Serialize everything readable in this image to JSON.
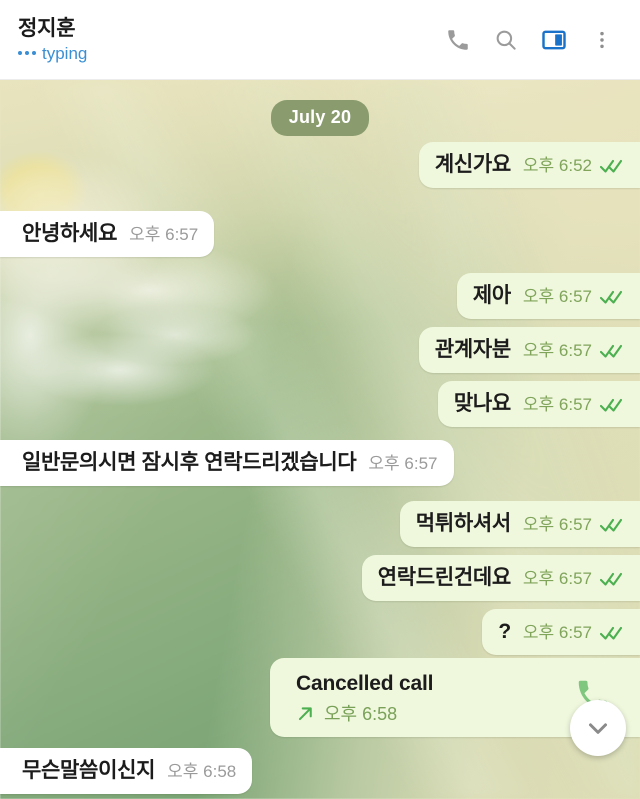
{
  "header": {
    "contact_name": "정지훈",
    "status": "typing",
    "status_color": "#3a8fd4",
    "actions": [
      {
        "name": "call-icon",
        "label": "Call"
      },
      {
        "name": "search-icon",
        "label": "Search"
      },
      {
        "name": "split-view-icon",
        "label": "Split view",
        "active": true,
        "color": "#1a73c8"
      },
      {
        "name": "more-options-icon",
        "label": "More options"
      }
    ]
  },
  "chat": {
    "date_badge": "July 20",
    "background": {
      "description": "blurred white daisy flower on green gradient",
      "green": "#86ab7d",
      "cream": "#e9e4be",
      "petal_white": "#ffffff",
      "center_yellow": "#f0d62c"
    },
    "colors": {
      "outgoing_bubble": "#eff7dd",
      "incoming_bubble": "#ffffff",
      "outgoing_time": "#7fa45a",
      "incoming_time": "#9a9a9a",
      "tick_green": "#4caf50",
      "date_badge_bg": "#8a9c6e"
    },
    "messages": [
      {
        "id": "m1",
        "dir": "out",
        "text": "계신가요",
        "time": "오후 6:52",
        "ticks": "double"
      },
      {
        "id": "m2",
        "dir": "in",
        "text": "안녕하세요",
        "time": "오후 6:57",
        "ticks": "none"
      },
      {
        "id": "m3",
        "dir": "out",
        "text": "제아",
        "time": "오후 6:57",
        "ticks": "double"
      },
      {
        "id": "m4",
        "dir": "out",
        "text": "관계자분",
        "time": "오후 6:57",
        "ticks": "double"
      },
      {
        "id": "m5",
        "dir": "out",
        "text": "맞나요",
        "time": "오후 6:57",
        "ticks": "double"
      },
      {
        "id": "m6",
        "dir": "in",
        "text": "일반문의시면 잠시후 연락드리겠습니다",
        "time": "오후 6:57",
        "ticks": "none"
      },
      {
        "id": "m7",
        "dir": "out",
        "text": "먹튀하셔서",
        "time": "오후 6:57",
        "ticks": "double"
      },
      {
        "id": "m8",
        "dir": "out",
        "text": "연락드린건데요",
        "time": "오후 6:57",
        "ticks": "double"
      },
      {
        "id": "m9",
        "dir": "out",
        "text": "?",
        "time": "오후 6:57",
        "ticks": "double"
      },
      {
        "id": "m11",
        "dir": "in",
        "text": "무슨말씀이신지",
        "time": "오후 6:58",
        "ticks": "none"
      }
    ],
    "call_event": {
      "id": "m10",
      "dir": "out",
      "title": "Cancelled call",
      "direction_arrow": "↗",
      "time": "오후 6:58",
      "icon": "phone-icon"
    },
    "scroll_button": {
      "name": "scroll-to-bottom-button",
      "icon": "chevron-down-icon"
    }
  }
}
